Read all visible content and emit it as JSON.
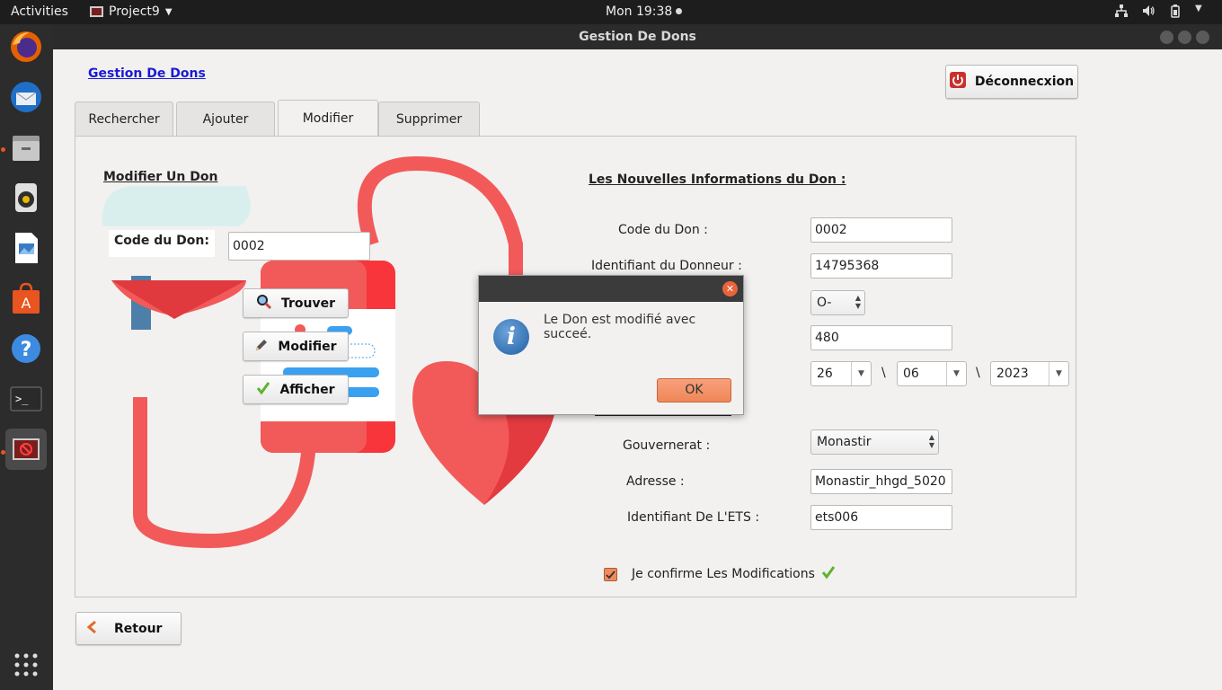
{
  "topbar": {
    "activities": "Activities",
    "app_name": "Project9",
    "clock": "Mon 19:38"
  },
  "dock": {
    "items": [
      "firefox-icon",
      "thunderbird-icon",
      "files-icon",
      "rhythmbox-icon",
      "libreoffice-impress-icon",
      "software-icon",
      "help-icon",
      "terminal-icon",
      "java-app-icon",
      "show-apps-icon"
    ]
  },
  "window": {
    "title": "Gestion De Dons"
  },
  "header": {
    "title_link": "Gestion De Dons",
    "logout_label": "Déconnecxion"
  },
  "tabs": [
    {
      "label": "Rechercher"
    },
    {
      "label": "Ajouter"
    },
    {
      "label": "Modifier",
      "selected": true
    },
    {
      "label": "Supprimer"
    }
  ],
  "left_section": {
    "heading": "Modifier Un Don",
    "code_label": "Code du Don:",
    "code_value": "0002",
    "buttons": {
      "find": "Trouver",
      "edit": "Modifier",
      "show": "Afficher"
    }
  },
  "form": {
    "heading": "Les Nouvelles Informations du Don :",
    "code_label": "Code du Don :",
    "code_value": "0002",
    "donor_id_label": "Identifiant du Donneur :",
    "donor_id_value": "14795368",
    "blood_group_value": "O-",
    "quantity_value": "480",
    "date_day": "26",
    "date_month": "06",
    "date_year": "2023",
    "date_sep": "\\",
    "gouvernorat_label": "Gouvernerat :",
    "gouvernorat_value": "Monastir",
    "address_label": "Adresse :",
    "address_value": "Monastir_hhgd_5020",
    "ets_label": "Identifiant De L'ETS :",
    "ets_value": "ets006",
    "confirm_label": "Je confirme Les Modifications",
    "confirm_checked": true
  },
  "footer": {
    "back_label": "Retour"
  },
  "dialog": {
    "message": "Le Don est modifié avec succeé.",
    "ok_label": "OK"
  },
  "colors": {
    "accent_orange": "#e95420",
    "link_blue": "#1a1ad6",
    "heart_red": "#f25a5a"
  }
}
